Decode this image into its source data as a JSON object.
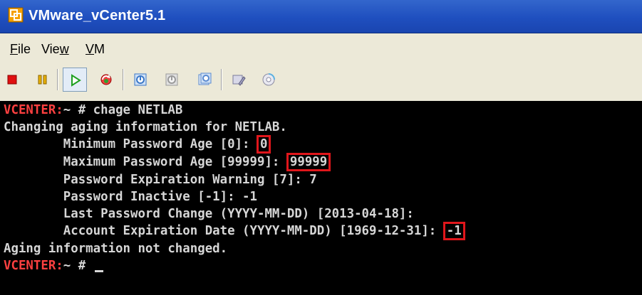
{
  "window": {
    "title": "VMware_vCenter5.1",
    "icon": "vmware-logo-icon"
  },
  "menubar": {
    "items": [
      {
        "label": "File",
        "mnemonic": "F",
        "rest": "ile"
      },
      {
        "label": "View",
        "mnemonic": "w",
        "before": "Vie"
      },
      {
        "label": "VM",
        "mnemonic": "V",
        "rest": "M"
      }
    ]
  },
  "toolbar": {
    "buttons": [
      {
        "name": "power-off-icon",
        "color": "#e01010"
      },
      {
        "name": "suspend-icon",
        "color": "#e8b000"
      },
      {
        "name": "power-on-icon",
        "color": "#20a020",
        "active": true
      },
      {
        "name": "reset-icon",
        "color": "#d02020"
      },
      {
        "name": "snapshot-icon",
        "color": "#3a78c8"
      },
      {
        "name": "revert-snapshot-icon",
        "color": "#9a9a9a"
      },
      {
        "name": "snapshot-manager-icon",
        "color": "#5a8ad0"
      },
      {
        "name": "vm-settings-icon",
        "color": "#7a7a9a"
      },
      {
        "name": "cd-dvd-icon",
        "color": "#b0b0c0"
      }
    ]
  },
  "console": {
    "prompt_host": "VCENTER:",
    "prompt_rest": "~ # ",
    "command": "chage NETLAB",
    "line2": "Changing aging information for NETLAB.",
    "min_label": "        Minimum Password Age [0]: ",
    "min_value": "0",
    "max_label": "        Maximum Password Age [99999]: ",
    "max_value": "99999",
    "warn_line": "        Password Expiration Warning [7]: 7",
    "inactive_line": "        Password Inactive [-1]: -1",
    "last_change_line": "        Last Password Change (YYYY-MM-DD) [2013-04-18]:",
    "acct_label": "        Account Expiration Date (YYYY-MM-DD) [1969-12-31]: ",
    "acct_value": "-1",
    "result_line": "Aging information not changed.",
    "prompt2_host": "VCENTER:",
    "prompt2_rest": "~ # "
  }
}
